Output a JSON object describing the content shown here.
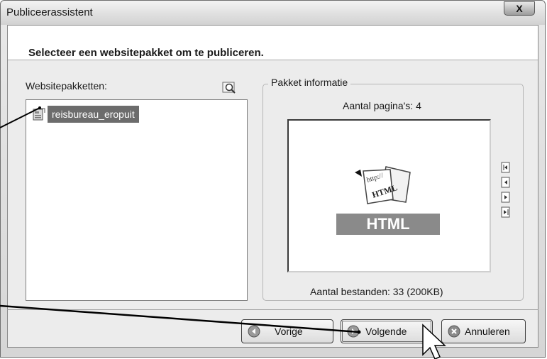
{
  "window": {
    "title": "Publiceerassistent",
    "close_label": "X"
  },
  "header": {
    "heading": "Selecteer een websitepakket om te publiceren."
  },
  "packages": {
    "label": "Websitepakketten:",
    "items": [
      {
        "label": "reisbureau_eropuit",
        "selected": true
      }
    ]
  },
  "info": {
    "legend": "Pakket informatie",
    "pages": "Aantal pagina's: 4",
    "files": "Aantal bestanden: 33   (200KB)",
    "logo_text": "HTML",
    "logo_subtext": "http://"
  },
  "buttons": {
    "previous": "Vorige",
    "next": "Volgende",
    "cancel": "Annuleren"
  },
  "colors": {
    "selection": "#6c6c6c",
    "logo_band": "#8a8a8a"
  }
}
